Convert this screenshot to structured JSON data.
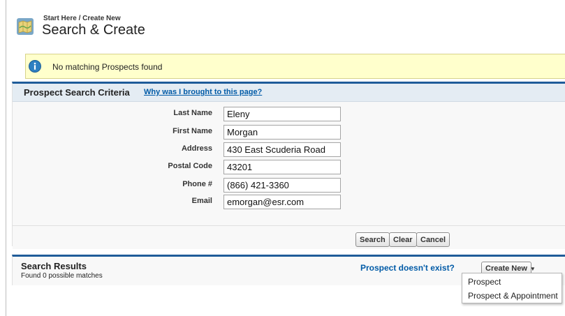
{
  "header": {
    "breadcrumb": "Start Here / Create New",
    "title": "Search & Create"
  },
  "alert": {
    "message": "No matching Prospects found",
    "icon": "info-icon"
  },
  "criteria": {
    "title": "Prospect Search Criteria",
    "help_link": "Why was I brought to this page?",
    "fields": [
      {
        "label": "Last Name",
        "value": "Eleny"
      },
      {
        "label": "First Name",
        "value": "Morgan"
      },
      {
        "label": "Address",
        "value": "430 East Scuderia Road"
      },
      {
        "label": "Postal Code",
        "value": "43201"
      },
      {
        "label": "Phone #",
        "value": "(866) 421-3360"
      },
      {
        "label": "Email",
        "value": "emorgan@esr.com"
      }
    ],
    "buttons": {
      "search": "Search",
      "clear": "Clear",
      "cancel": "Cancel"
    }
  },
  "results": {
    "title": "Search Results",
    "count_text": "Found 0 possible matches",
    "prompt": "Prospect doesn't exist?",
    "create_new": "Create New",
    "menu": [
      "Prospect",
      "Prospect & Appointment"
    ]
  },
  "colors": {
    "accent": "#1f5c99",
    "link": "#015ba7",
    "alert_bg": "#ffffcc"
  }
}
